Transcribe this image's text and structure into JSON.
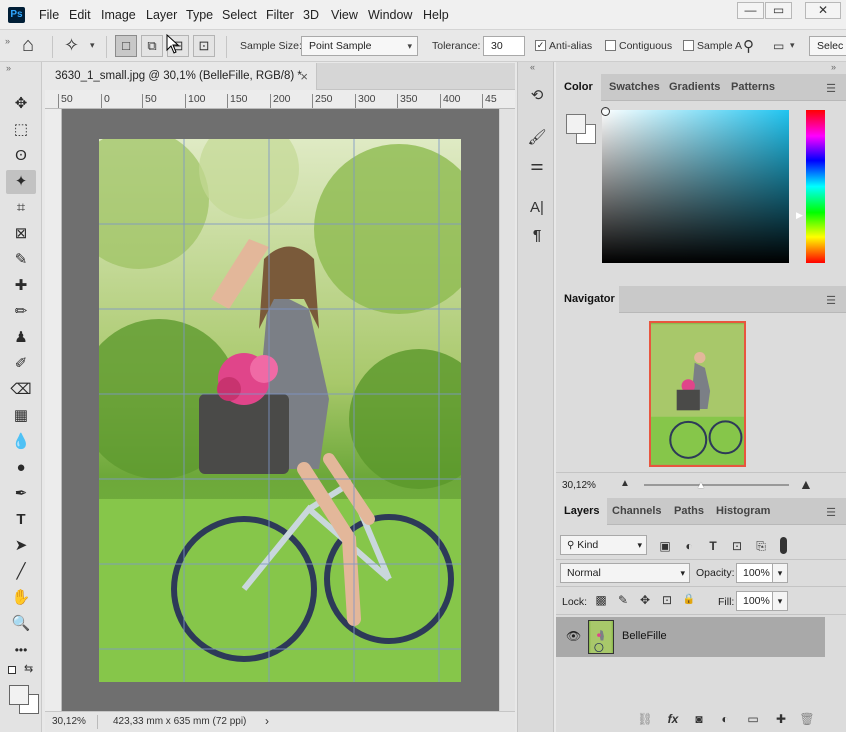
{
  "app": {
    "logo": "Ps"
  },
  "menu": [
    "File",
    "Edit",
    "Image",
    "Layer",
    "Type",
    "Select",
    "Filter",
    "3D",
    "View",
    "Window",
    "Help"
  ],
  "window_controls": [
    "—",
    "▭",
    "✕"
  ],
  "options_bar": {
    "home_icon": "⌂",
    "wand_icon": "✧",
    "mode_icons": [
      "□",
      "⧉",
      "⊟",
      "⊡"
    ],
    "sample_size_label": "Sample Size:",
    "sample_size_value": "Point Sample",
    "tolerance_label": "Tolerance:",
    "tolerance_value": "30",
    "anti_alias_label": "Anti-alias",
    "anti_alias_checked": true,
    "contiguous_label": "Contiguous",
    "contiguous_checked": false,
    "sample_all_label": "Sample A",
    "select_label": "Selec"
  },
  "tools": [
    "✥",
    "⬚",
    "ʘ",
    "✦",
    "⌗",
    "⊠",
    "✎",
    "✚",
    "✏",
    "♟",
    "✐",
    "⌫",
    "▦",
    "💧",
    "●",
    "✒",
    "T",
    "➤",
    "╱",
    "✋",
    "🔍",
    "•••"
  ],
  "document": {
    "tab_title": "3630_1_small.jpg @ 30,1% (BelleFille, RGB/8) *",
    "close_icon": "×",
    "ruler_ticks": [
      "50",
      "0",
      "50",
      "100",
      "150",
      "200",
      "250",
      "300",
      "350",
      "400",
      "45"
    ],
    "zoom": "30,12%",
    "doc_size": "423,33 mm x 635 mm (72 ppi)",
    "status_arrow": "›"
  },
  "mid_tools": [
    "⟲",
    "🖌",
    "⚌",
    "A|",
    "¶"
  ],
  "color_panel": {
    "tabs": [
      "Color",
      "Swatches",
      "Gradients",
      "Patterns"
    ],
    "foreground": "#f2f2f2",
    "background": "#ffffff"
  },
  "navigator": {
    "tab": "Navigator",
    "zoom": "30,12%"
  },
  "layers_panel": {
    "tabs": [
      "Layers",
      "Channels",
      "Paths",
      "Histogram"
    ],
    "filter_kind": "Kind",
    "blend_mode": "Normal",
    "opacity_label": "Opacity:",
    "opacity_value": "100%",
    "lock_label": "Lock:",
    "fill_label": "Fill:",
    "fill_value": "100%",
    "layer_name": "BelleFille",
    "filter_icons": [
      "▣",
      "◐",
      "T",
      "⊡",
      "⎘"
    ],
    "lock_icons": [
      "▩",
      "✎",
      "✥",
      "⊡",
      "🔒"
    ],
    "footer_icons": [
      "⛓",
      "fx",
      "◙",
      "◐",
      "▭",
      "✚",
      "🗑"
    ]
  },
  "colors": {
    "accent_red": "#e8563f"
  }
}
